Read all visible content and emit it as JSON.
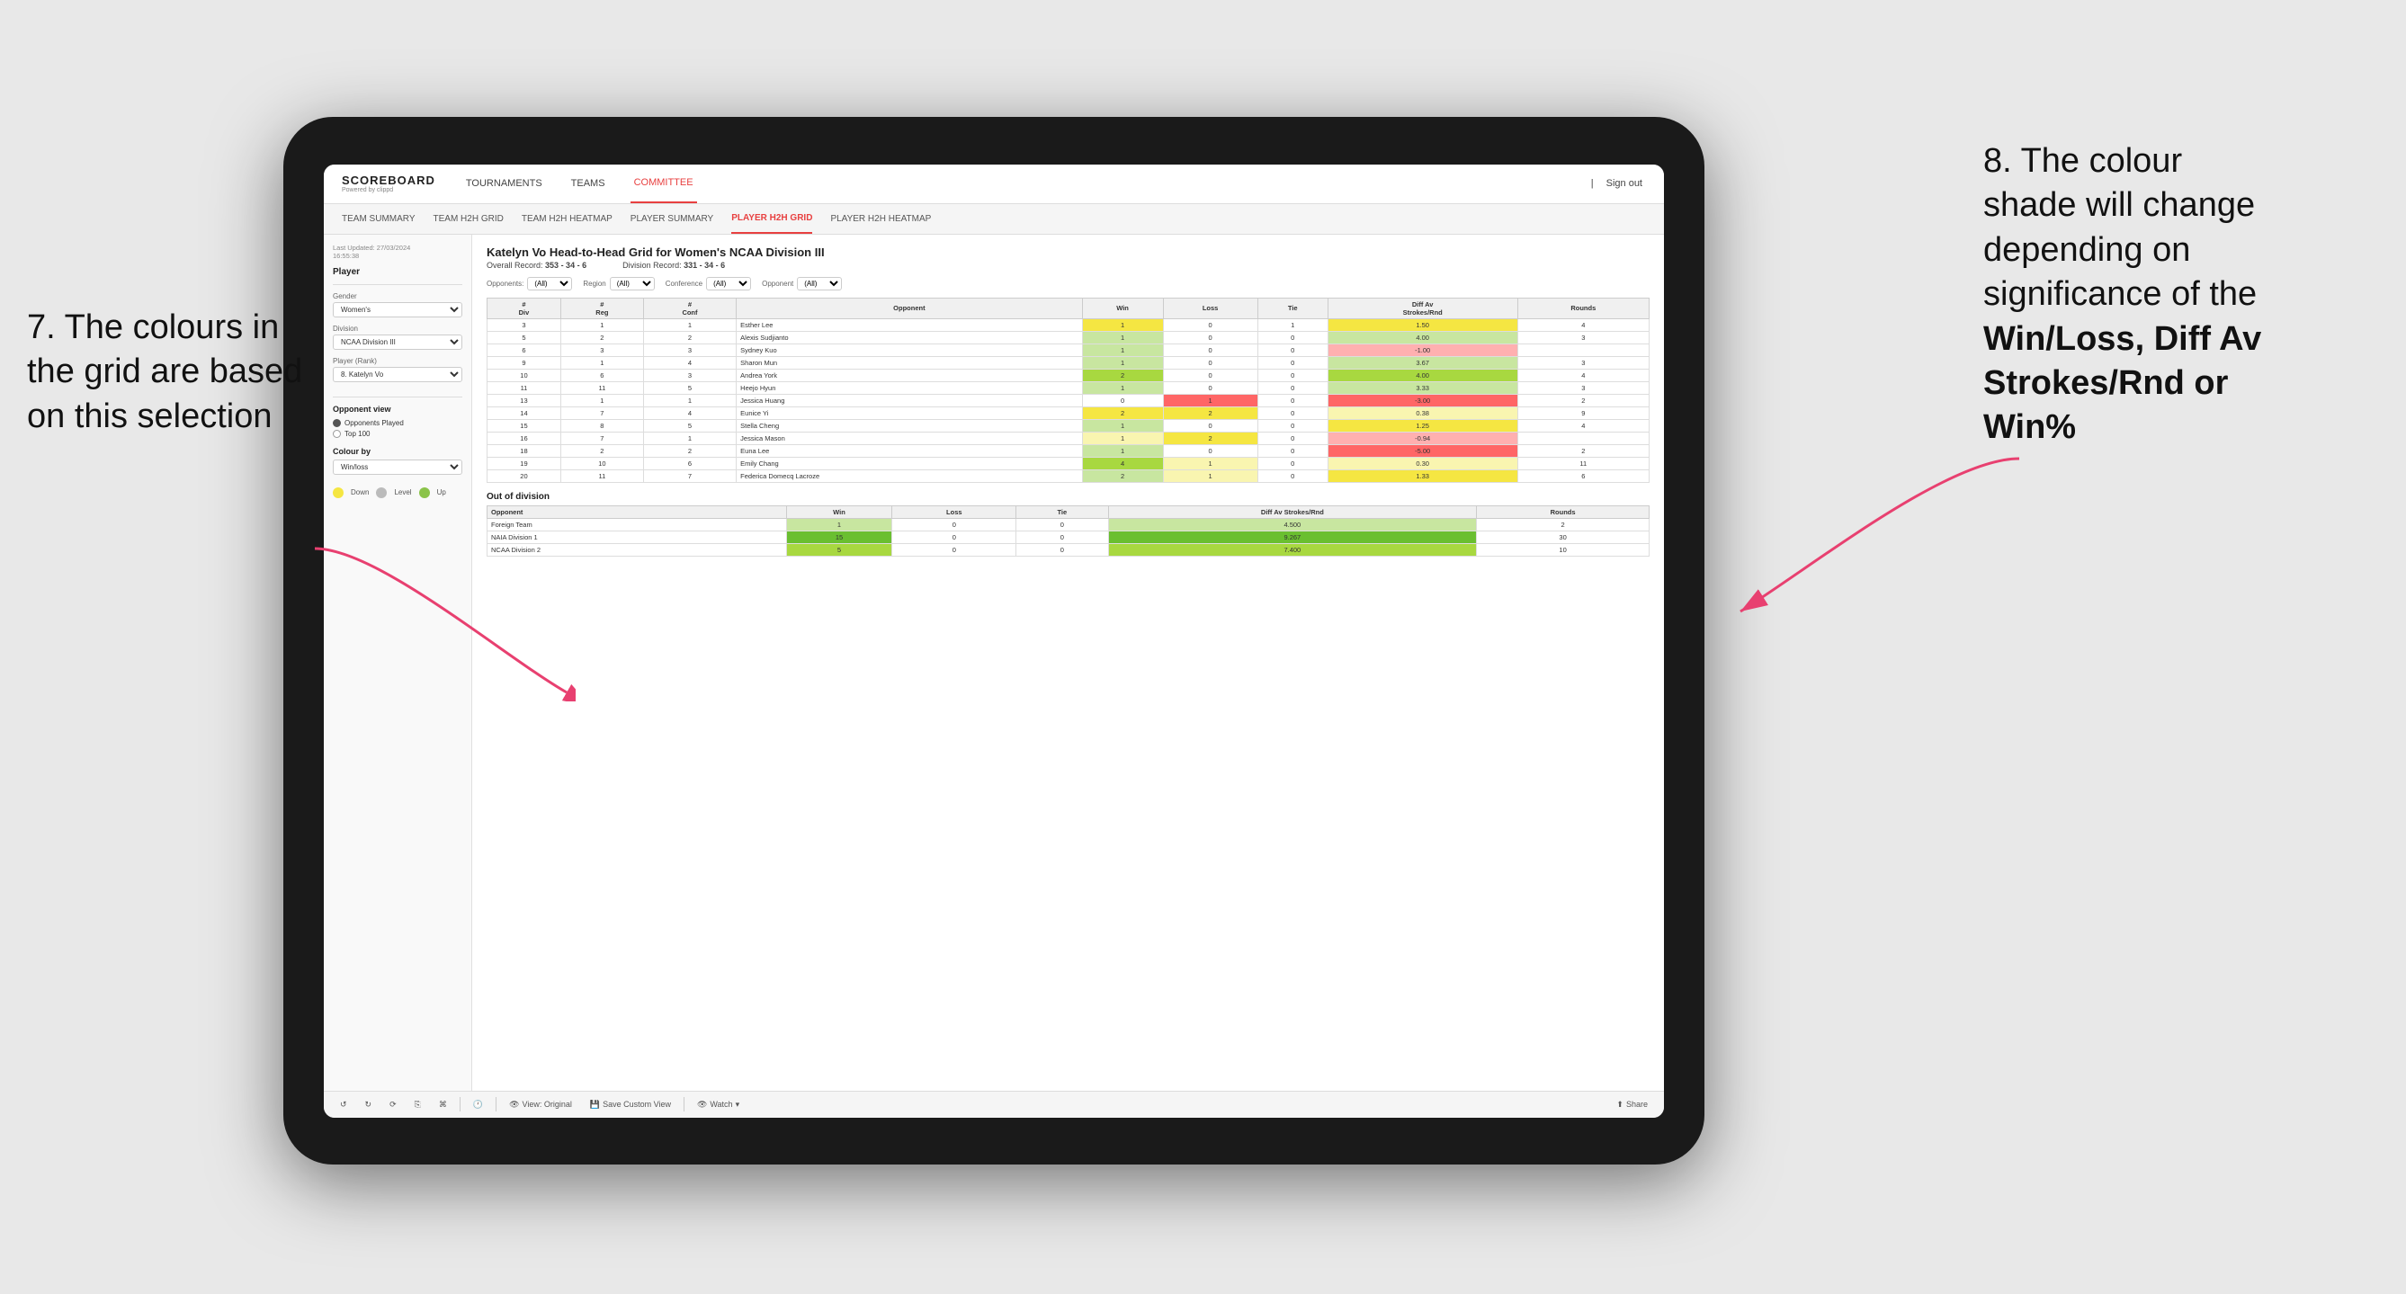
{
  "annotations": {
    "left": {
      "line1": "7. The colours in",
      "line2": "the grid are based",
      "line3": "on this selection"
    },
    "right": {
      "line1": "8. The colour",
      "line2": "shade will change",
      "line3": "depending on",
      "line4": "significance of the",
      "bold1": "Win/Loss",
      "comma1": ", ",
      "bold2": "Diff Av",
      "line5": "Strokes/Rnd",
      "line6": " or",
      "bold3": "Win%"
    }
  },
  "nav": {
    "logo": "SCOREBOARD",
    "logo_sub": "Powered by clippd",
    "items": [
      "TOURNAMENTS",
      "TEAMS",
      "COMMITTEE"
    ],
    "active_item": "COMMITTEE",
    "sign_out": "Sign out"
  },
  "secondary_nav": {
    "items": [
      "TEAM SUMMARY",
      "TEAM H2H GRID",
      "TEAM H2H HEATMAP",
      "PLAYER SUMMARY",
      "PLAYER H2H GRID",
      "PLAYER H2H HEATMAP"
    ],
    "active": "PLAYER H2H GRID"
  },
  "sidebar": {
    "timestamp": "Last Updated: 27/03/2024",
    "timestamp2": "16:55:38",
    "player_label": "Player",
    "gender_label": "Gender",
    "gender_value": "Women's",
    "division_label": "Division",
    "division_value": "NCAA Division III",
    "player_rank_label": "Player (Rank)",
    "player_rank_value": "8. Katelyn Vo",
    "opponent_view_label": "Opponent view",
    "radio1": "Opponents Played",
    "radio2": "Top 100",
    "colour_by_label": "Colour by",
    "colour_by_value": "Win/loss",
    "legend": {
      "down_label": "Down",
      "level_label": "Level",
      "up_label": "Up"
    }
  },
  "main": {
    "title": "Katelyn Vo Head-to-Head Grid for Women's NCAA Division III",
    "overall_record_label": "Overall Record:",
    "overall_record": "353 - 34 - 6",
    "division_record_label": "Division Record:",
    "division_record": "331 - 34 - 6",
    "filters": {
      "opponents_label": "Opponents:",
      "opponents_value": "(All)",
      "region_label": "Region",
      "region_value": "(All)",
      "conference_label": "Conference",
      "conference_value": "(All)",
      "opponent_label": "Opponent",
      "opponent_value": "(All)"
    },
    "table_headers": [
      "#\nDiv",
      "#\nReg",
      "#\nConf",
      "Opponent",
      "Win",
      "Loss",
      "Tie",
      "Diff Av\nStrokes/Rnd",
      "Rounds"
    ],
    "rows": [
      {
        "div": "3",
        "reg": "1",
        "conf": "1",
        "opponent": "Esther Lee",
        "win": "1",
        "loss": "0",
        "tie": "1",
        "diff": "1.50",
        "rounds": "4",
        "win_color": "yellow",
        "loss_color": "",
        "diff_color": "yellow"
      },
      {
        "div": "5",
        "reg": "2",
        "conf": "2",
        "opponent": "Alexis Sudjianto",
        "win": "1",
        "loss": "0",
        "tie": "0",
        "diff": "4.00",
        "rounds": "3",
        "win_color": "green_light",
        "loss_color": "",
        "diff_color": "green_light"
      },
      {
        "div": "6",
        "reg": "3",
        "conf": "3",
        "opponent": "Sydney Kuo",
        "win": "1",
        "loss": "0",
        "tie": "0",
        "diff": "-1.00",
        "rounds": "",
        "win_color": "green_light",
        "loss_color": "",
        "diff_color": "red_light"
      },
      {
        "div": "9",
        "reg": "1",
        "conf": "4",
        "opponent": "Sharon Mun",
        "win": "1",
        "loss": "0",
        "tie": "0",
        "diff": "3.67",
        "rounds": "3",
        "win_color": "green_light",
        "loss_color": "",
        "diff_color": "green_light"
      },
      {
        "div": "10",
        "reg": "6",
        "conf": "3",
        "opponent": "Andrea York",
        "win": "2",
        "loss": "0",
        "tie": "0",
        "diff": "4.00",
        "rounds": "4",
        "win_color": "green_medium",
        "loss_color": "",
        "diff_color": "green_medium"
      },
      {
        "div": "11",
        "reg": "11",
        "conf": "5",
        "opponent": "Heejo Hyun",
        "win": "1",
        "loss": "0",
        "tie": "0",
        "diff": "3.33",
        "rounds": "3",
        "win_color": "green_light",
        "loss_color": "",
        "diff_color": "green_light"
      },
      {
        "div": "13",
        "reg": "1",
        "conf": "1",
        "opponent": "Jessica Huang",
        "win": "0",
        "loss": "1",
        "tie": "0",
        "diff": "-3.00",
        "rounds": "2",
        "win_color": "",
        "loss_color": "red_medium",
        "diff_color": "red_medium"
      },
      {
        "div": "14",
        "reg": "7",
        "conf": "4",
        "opponent": "Eunice Yi",
        "win": "2",
        "loss": "2",
        "tie": "0",
        "diff": "0.38",
        "rounds": "9",
        "win_color": "yellow",
        "loss_color": "yellow",
        "diff_color": "yellow_light"
      },
      {
        "div": "15",
        "reg": "8",
        "conf": "5",
        "opponent": "Stella Cheng",
        "win": "1",
        "loss": "0",
        "tie": "0",
        "diff": "1.25",
        "rounds": "4",
        "win_color": "green_light",
        "loss_color": "",
        "diff_color": "yellow"
      },
      {
        "div": "16",
        "reg": "7",
        "conf": "1",
        "opponent": "Jessica Mason",
        "win": "1",
        "loss": "2",
        "tie": "0",
        "diff": "-0.94",
        "rounds": "",
        "win_color": "yellow_light",
        "loss_color": "yellow",
        "diff_color": "red_light"
      },
      {
        "div": "18",
        "reg": "2",
        "conf": "2",
        "opponent": "Euna Lee",
        "win": "1",
        "loss": "0",
        "tie": "0",
        "diff": "-5.00",
        "rounds": "2",
        "win_color": "green_light",
        "loss_color": "",
        "diff_color": "red_medium"
      },
      {
        "div": "19",
        "reg": "10",
        "conf": "6",
        "opponent": "Emily Chang",
        "win": "4",
        "loss": "1",
        "tie": "0",
        "diff": "0.30",
        "rounds": "11",
        "win_color": "green_medium",
        "loss_color": "yellow_light",
        "diff_color": "yellow_light"
      },
      {
        "div": "20",
        "reg": "11",
        "conf": "7",
        "opponent": "Federica Domecq Lacroze",
        "win": "2",
        "loss": "1",
        "tie": "0",
        "diff": "1.33",
        "rounds": "6",
        "win_color": "green_light",
        "loss_color": "yellow_light",
        "diff_color": "yellow"
      }
    ],
    "out_of_division_label": "Out of division",
    "out_of_division_rows": [
      {
        "opponent": "Foreign Team",
        "win": "1",
        "loss": "0",
        "tie": "0",
        "diff": "4.500",
        "rounds": "2",
        "win_color": "green_light"
      },
      {
        "opponent": "NAIA Division 1",
        "win": "15",
        "loss": "0",
        "tie": "0",
        "diff": "9.267",
        "rounds": "30",
        "win_color": "green_bright"
      },
      {
        "opponent": "NCAA Division 2",
        "win": "5",
        "loss": "0",
        "tie": "0",
        "diff": "7.400",
        "rounds": "10",
        "win_color": "green_medium"
      }
    ]
  },
  "toolbar": {
    "view_original": "View: Original",
    "save_custom_view": "Save Custom View",
    "watch": "Watch",
    "share": "Share"
  }
}
